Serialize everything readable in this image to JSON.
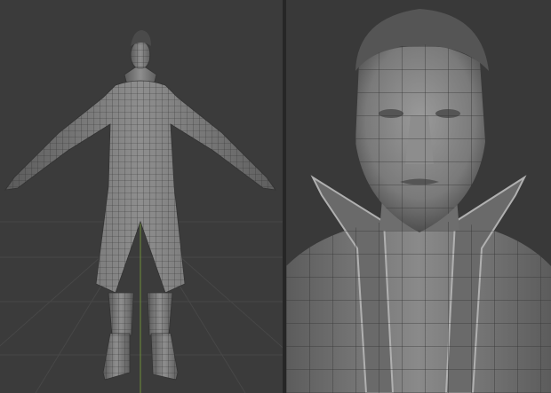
{
  "viewports": [
    {
      "id": "full-body-view",
      "shading": "wireframe-on-shaded"
    },
    {
      "id": "head-closeup-view",
      "shading": "wireframe-on-shaded"
    }
  ],
  "colors": {
    "background": "#3b3b3b",
    "grid": "#4a4a4a",
    "model": "#8a8a8a",
    "wire": "#2c2c2c",
    "axis_green": "#6f8f3a",
    "axis_red": "#8f3a3a"
  }
}
